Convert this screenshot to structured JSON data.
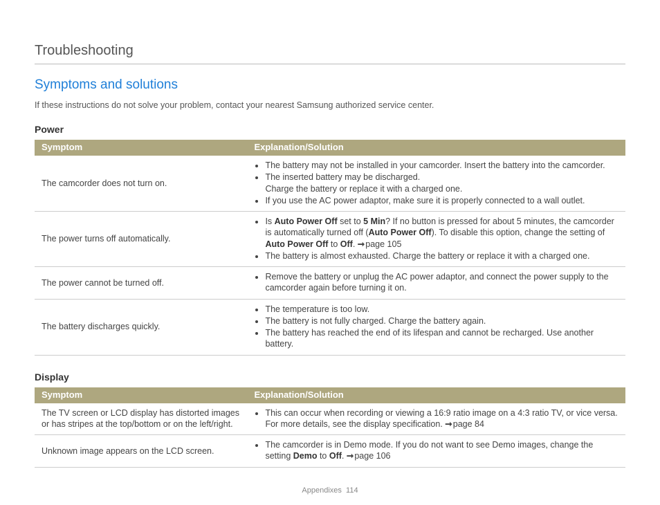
{
  "chapter": "Troubleshooting",
  "heading": "Symptoms and solutions",
  "intro": "If these instructions do not solve your problem, contact your nearest Samsung authorized service center.",
  "sections": {
    "power": {
      "title": "Power",
      "headers": {
        "symptom": "Symptom",
        "solution": "Explanation/Solution"
      },
      "rows": [
        {
          "symptom": "The camcorder does not turn on.",
          "html": "<ul><li>The battery may not be installed in your camcorder. Insert the battery into the camcorder.</li><li>The inserted battery may be discharged.<br>Charge the battery or replace it with a charged one.</li><li>If you use the AC power adaptor, make sure it is properly connected to a wall outlet.</li></ul>"
        },
        {
          "symptom": "The power turns off automatically.",
          "html": "<ul><li>Is <b>Auto Power Off</b> set to <b>5 Min</b>? If no button is pressed for about 5 minutes, the camcorder is automatically turned off (<b>Auto Power Off</b>). To disable this option, change the setting of <b>Auto Power Off</b> to <b>Off</b>. <span class='arrow'></span>page 105</li><li>The battery is almost exhausted. Charge the battery or replace it with a charged one.</li></ul>"
        },
        {
          "symptom": "The power cannot be turned off.",
          "html": "<ul><li>Remove the battery or unplug the AC power adaptor, and connect the power supply to the camcorder again before turning it on.</li></ul>"
        },
        {
          "symptom": "The battery discharges quickly.",
          "html": "<ul><li>The temperature is too low.</li><li>The battery is not fully charged. Charge the battery again.</li><li>The battery has reached the end of its lifespan and cannot be recharged. Use another battery.</li></ul>"
        }
      ]
    },
    "display": {
      "title": "Display",
      "headers": {
        "symptom": "Symptom",
        "solution": "Explanation/Solution"
      },
      "rows": [
        {
          "symptom": "The TV screen or LCD display has distorted images or has stripes at the top/bottom or on the left/right.",
          "html": "<ul><li>This can occur when recording or viewing a 16:9 ratio image on a 4:3 ratio TV, or vice versa. For more details, see the display specification. <span class='arrow'></span>page 84</li></ul>"
        },
        {
          "symptom": "Unknown image appears on the LCD screen.",
          "html": "<ul><li>The camcorder is in Demo mode. If you do not want to see Demo images, change the setting <b>Demo</b> to <b>Off</b>. <span class='arrow'></span>page 106</li></ul>"
        }
      ]
    }
  },
  "footer": {
    "section": "Appendixes",
    "page": "114"
  }
}
